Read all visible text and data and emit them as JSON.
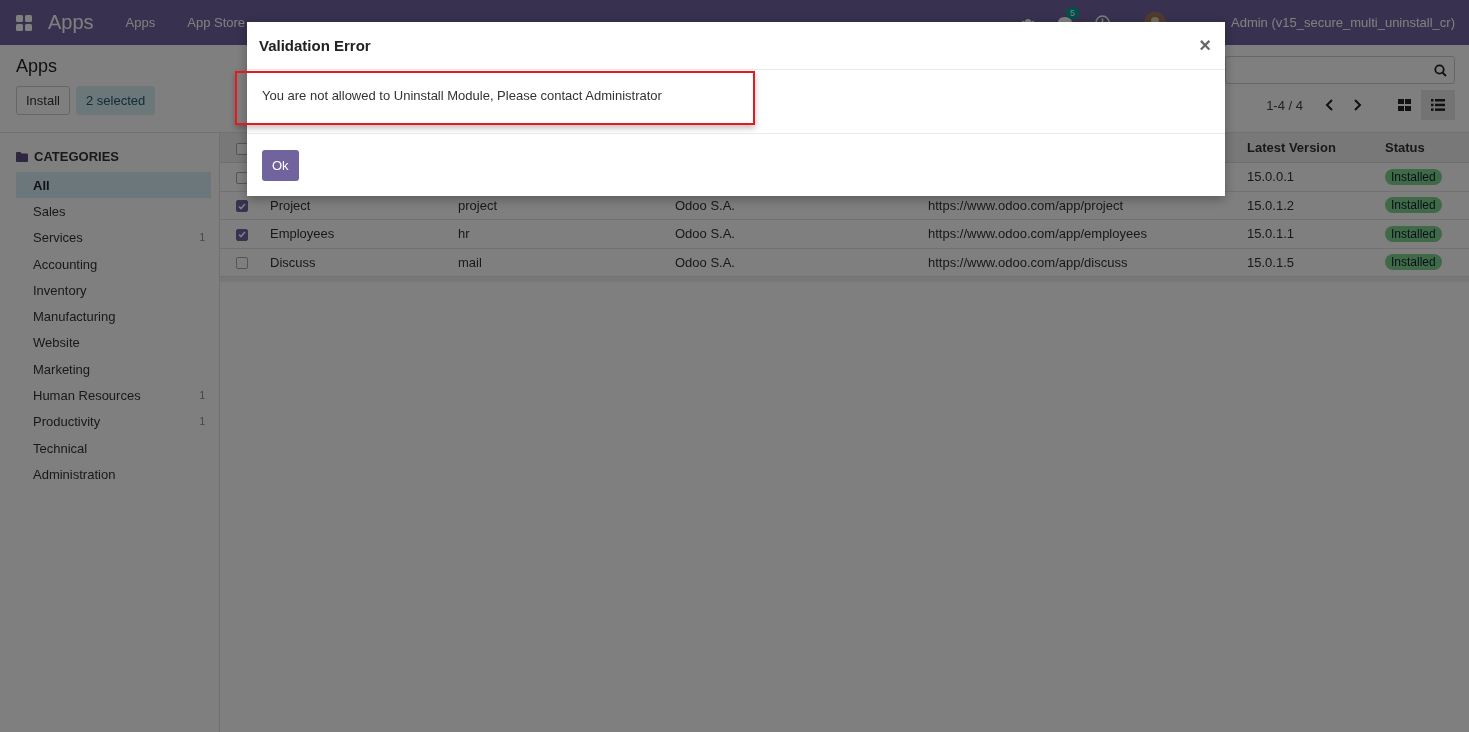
{
  "navbar": {
    "app_name": "Apps",
    "menu": [
      "Apps",
      "App Store"
    ],
    "chat_count": "5",
    "user_name": "Admin (v15_secure_multi_uninstall_cr)"
  },
  "control_panel": {
    "title": "Apps",
    "buttons": [
      {
        "label": "Install",
        "kind": "plain"
      },
      {
        "label": "2 selected",
        "kind": "selection"
      }
    ],
    "pager": "1-4 / 4",
    "views": [
      {
        "kind": "kanban",
        "selected": false
      },
      {
        "kind": "list",
        "selected": true
      }
    ]
  },
  "sidebar": {
    "heading": "CATEGORIES",
    "items": [
      {
        "label": "All",
        "selected": true
      },
      {
        "label": "Sales",
        "selected": false
      },
      {
        "label": "Services",
        "count": "1",
        "selected": false
      },
      {
        "label": "Accounting",
        "selected": false
      },
      {
        "label": "Inventory",
        "selected": false
      },
      {
        "label": "Manufacturing",
        "selected": false
      },
      {
        "label": "Website",
        "selected": false
      },
      {
        "label": "Marketing",
        "selected": false
      },
      {
        "label": "Human Resources",
        "count": "1",
        "selected": false
      },
      {
        "label": "Productivity",
        "count": "1",
        "selected": false
      },
      {
        "label": "Technical",
        "selected": false
      },
      {
        "label": "Administration",
        "selected": false
      }
    ]
  },
  "table": {
    "header_checked": false,
    "headers": {
      "version": "Latest Version",
      "status": "Status"
    },
    "rows": [
      {
        "checked": false,
        "version": "15.0.0.1",
        "status": "Installed"
      },
      {
        "checked": true,
        "name": "Project",
        "technical_name": "project",
        "author": "Odoo S.A.",
        "website": "https://www.odoo.com/app/project",
        "version": "15.0.1.2",
        "status": "Installed"
      },
      {
        "checked": true,
        "name": "Employees",
        "technical_name": "hr",
        "author": "Odoo S.A.",
        "website": "https://www.odoo.com/app/employees",
        "version": "15.0.1.1",
        "status": "Installed"
      },
      {
        "checked": false,
        "name": "Discuss",
        "technical_name": "mail",
        "author": "Odoo S.A.",
        "website": "https://www.odoo.com/app/discuss",
        "version": "15.0.1.5",
        "status": "Installed"
      }
    ]
  },
  "dialog": {
    "title": "Validation Error",
    "close": "×",
    "message": "You are not allowed to Uninstall Module, Please contact Administrator",
    "highlighted": true,
    "ok": "Ok"
  }
}
